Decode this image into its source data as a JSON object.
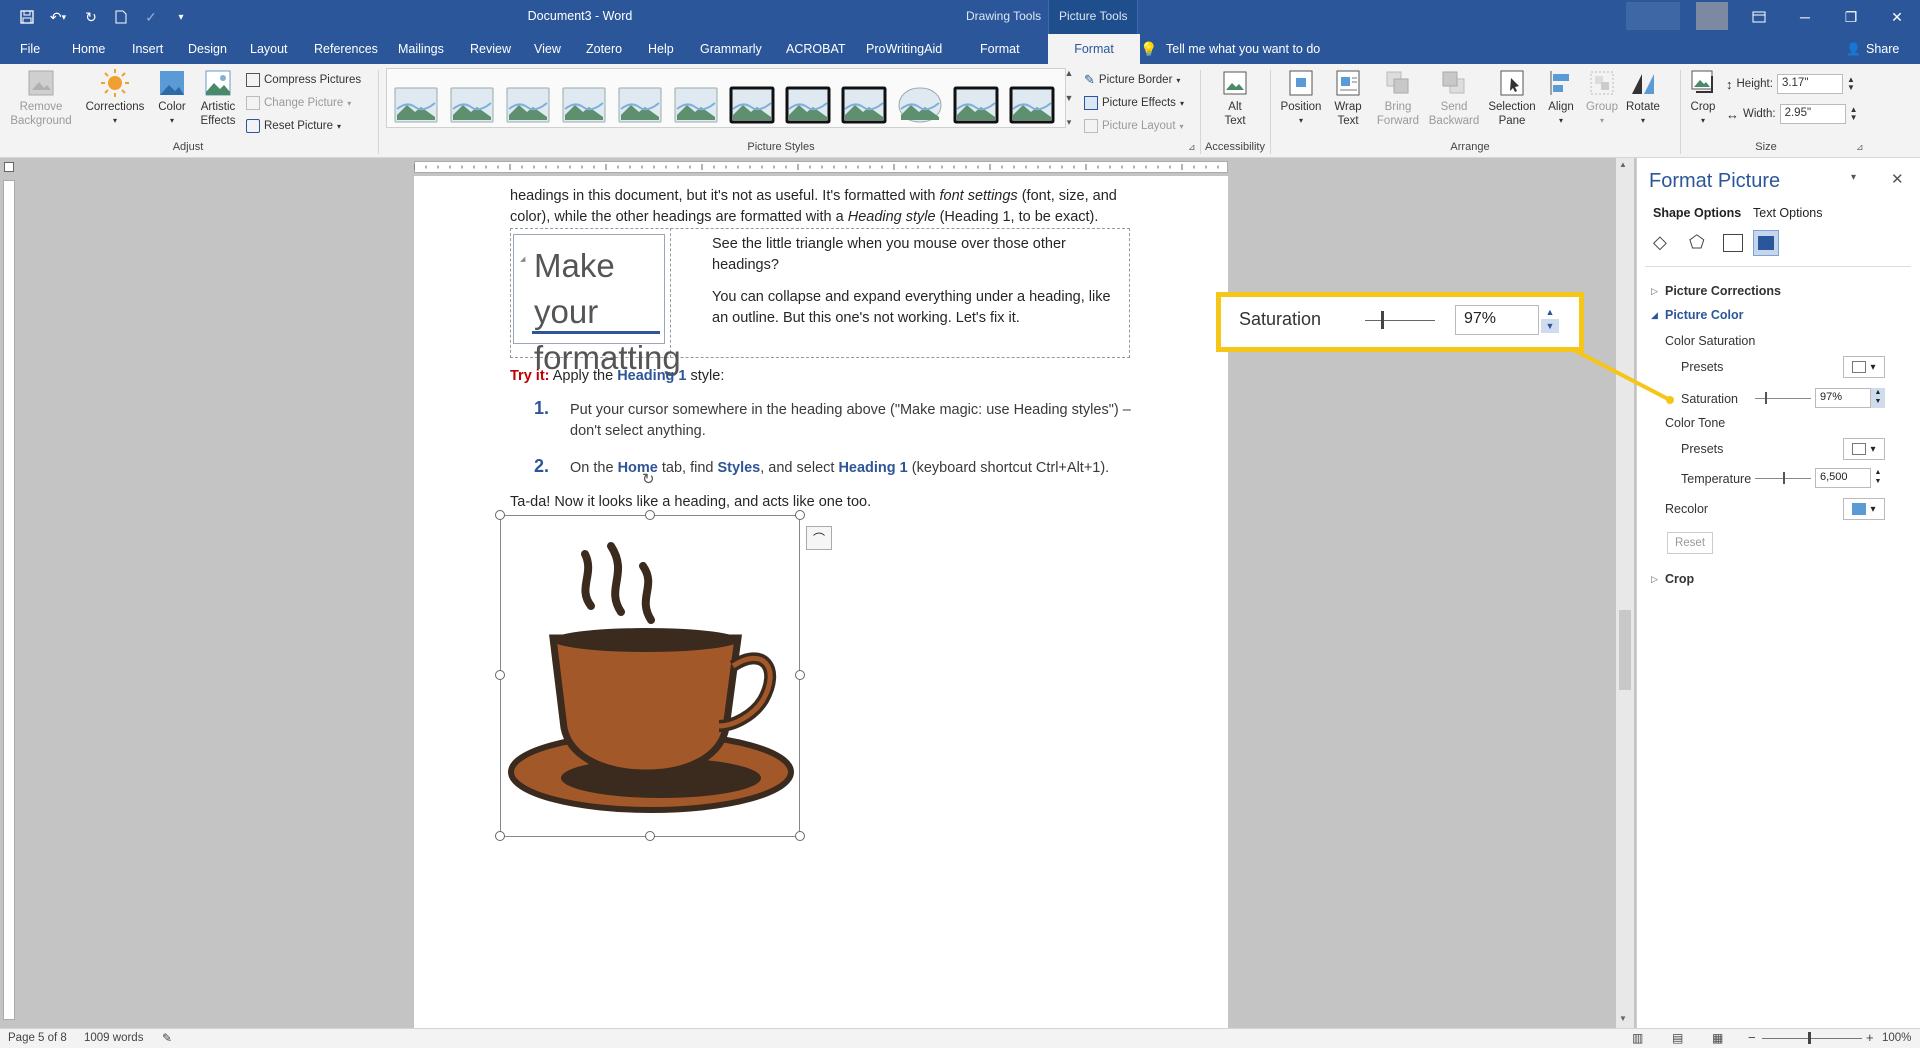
{
  "titlebar": {
    "doc_title": "Document3  -  Word",
    "ctx_drawing": "Drawing Tools",
    "ctx_picture": "Picture Tools"
  },
  "tabs": [
    "File",
    "Home",
    "Insert",
    "Design",
    "Layout",
    "References",
    "Mailings",
    "Review",
    "View",
    "Zotero",
    "Help",
    "Grammarly",
    "ACROBAT",
    "ProWritingAid",
    "Format",
    "Format"
  ],
  "tell_me": "Tell me what you want to do",
  "share": "Share",
  "ribbon": {
    "remove_bg": "Remove Background",
    "corrections": "Corrections",
    "color": "Color",
    "artistic": "Artistic Effects",
    "compress": "Compress Pictures",
    "change": "Change Picture",
    "reset": "Reset Picture",
    "adjust": "Adjust",
    "picture_styles": "Picture Styles",
    "border": "Picture Border",
    "effects": "Picture Effects",
    "layout": "Picture Layout",
    "alt_text": "Alt Text",
    "accessibility": "Accessibility",
    "position": "Position",
    "wrap": "Wrap Text",
    "bring": "Bring Forward",
    "send": "Send Backward",
    "selection": "Selection Pane",
    "align": "Align",
    "group": "Group",
    "rotate": "Rotate",
    "arrange": "Arrange",
    "crop": "Crop",
    "height_label": "Height:",
    "height_val": "3.17\"",
    "width_label": "Width:",
    "width_val": "2.95\"",
    "size": "Size"
  },
  "doc": {
    "p1a": "headings in this document, but it's not as useful. It's formatted with ",
    "p1b": "font settings",
    " p1c": "",
    "p1_line1": "headings in this document, but it's not as useful. It's formatted with font settings (font, size, and",
    "p1_line2": "color), while the other headings are formatted with a Heading style (Heading 1, to be exact).",
    "big1": "Make your",
    "big2": "formatting",
    "side1": "See the little triangle when you mouse over those other headings?",
    "side2": "You can collapse and expand everything under a heading, like an outline. But this one's not working. Let's fix it.",
    "try_label": "Try it:",
    "try_text1": " Apply the ",
    "try_h1": "Heading 1",
    "try_text2": " style:",
    "n1": "1.",
    "step1": "Put your cursor somewhere in the heading above (\"Make magic: use Heading styles\") – don't select anything.",
    "n2": "2.",
    "step2a": "On the ",
    "step2b": "Home",
    "step2c": " tab, find ",
    "step2d": "Styles",
    "step2e": ", and select ",
    "step2f": "Heading 1",
    "step2g": " (keyboard shortcut Ctrl+Alt+1).",
    "tada": "Ta-da! Now it looks like a heading, and acts like one too."
  },
  "pane": {
    "title": "Format Picture",
    "tab1": "Shape Options",
    "tab2": "Text Options",
    "corrections": "Picture Corrections",
    "picture_color": "Picture Color",
    "color_saturation": "Color Saturation",
    "presets": "Presets",
    "saturation": "Saturation",
    "saturation_val": "97%",
    "color_tone": "Color Tone",
    "presets2": "Presets",
    "temperature": "Temperature",
    "temperature_val": "6,500",
    "recolor": "Recolor",
    "reset": "Reset",
    "crop": "Crop"
  },
  "callout": {
    "label": "Saturation",
    "value": "97%"
  },
  "status": {
    "page": "Page 5 of 8",
    "words": "1009 words",
    "zoom": "100%"
  },
  "colors": {
    "word_blue": "#2b579a",
    "callout": "#f5c518",
    "heading_blue": "#2e5597",
    "try_red": "#c00000"
  }
}
